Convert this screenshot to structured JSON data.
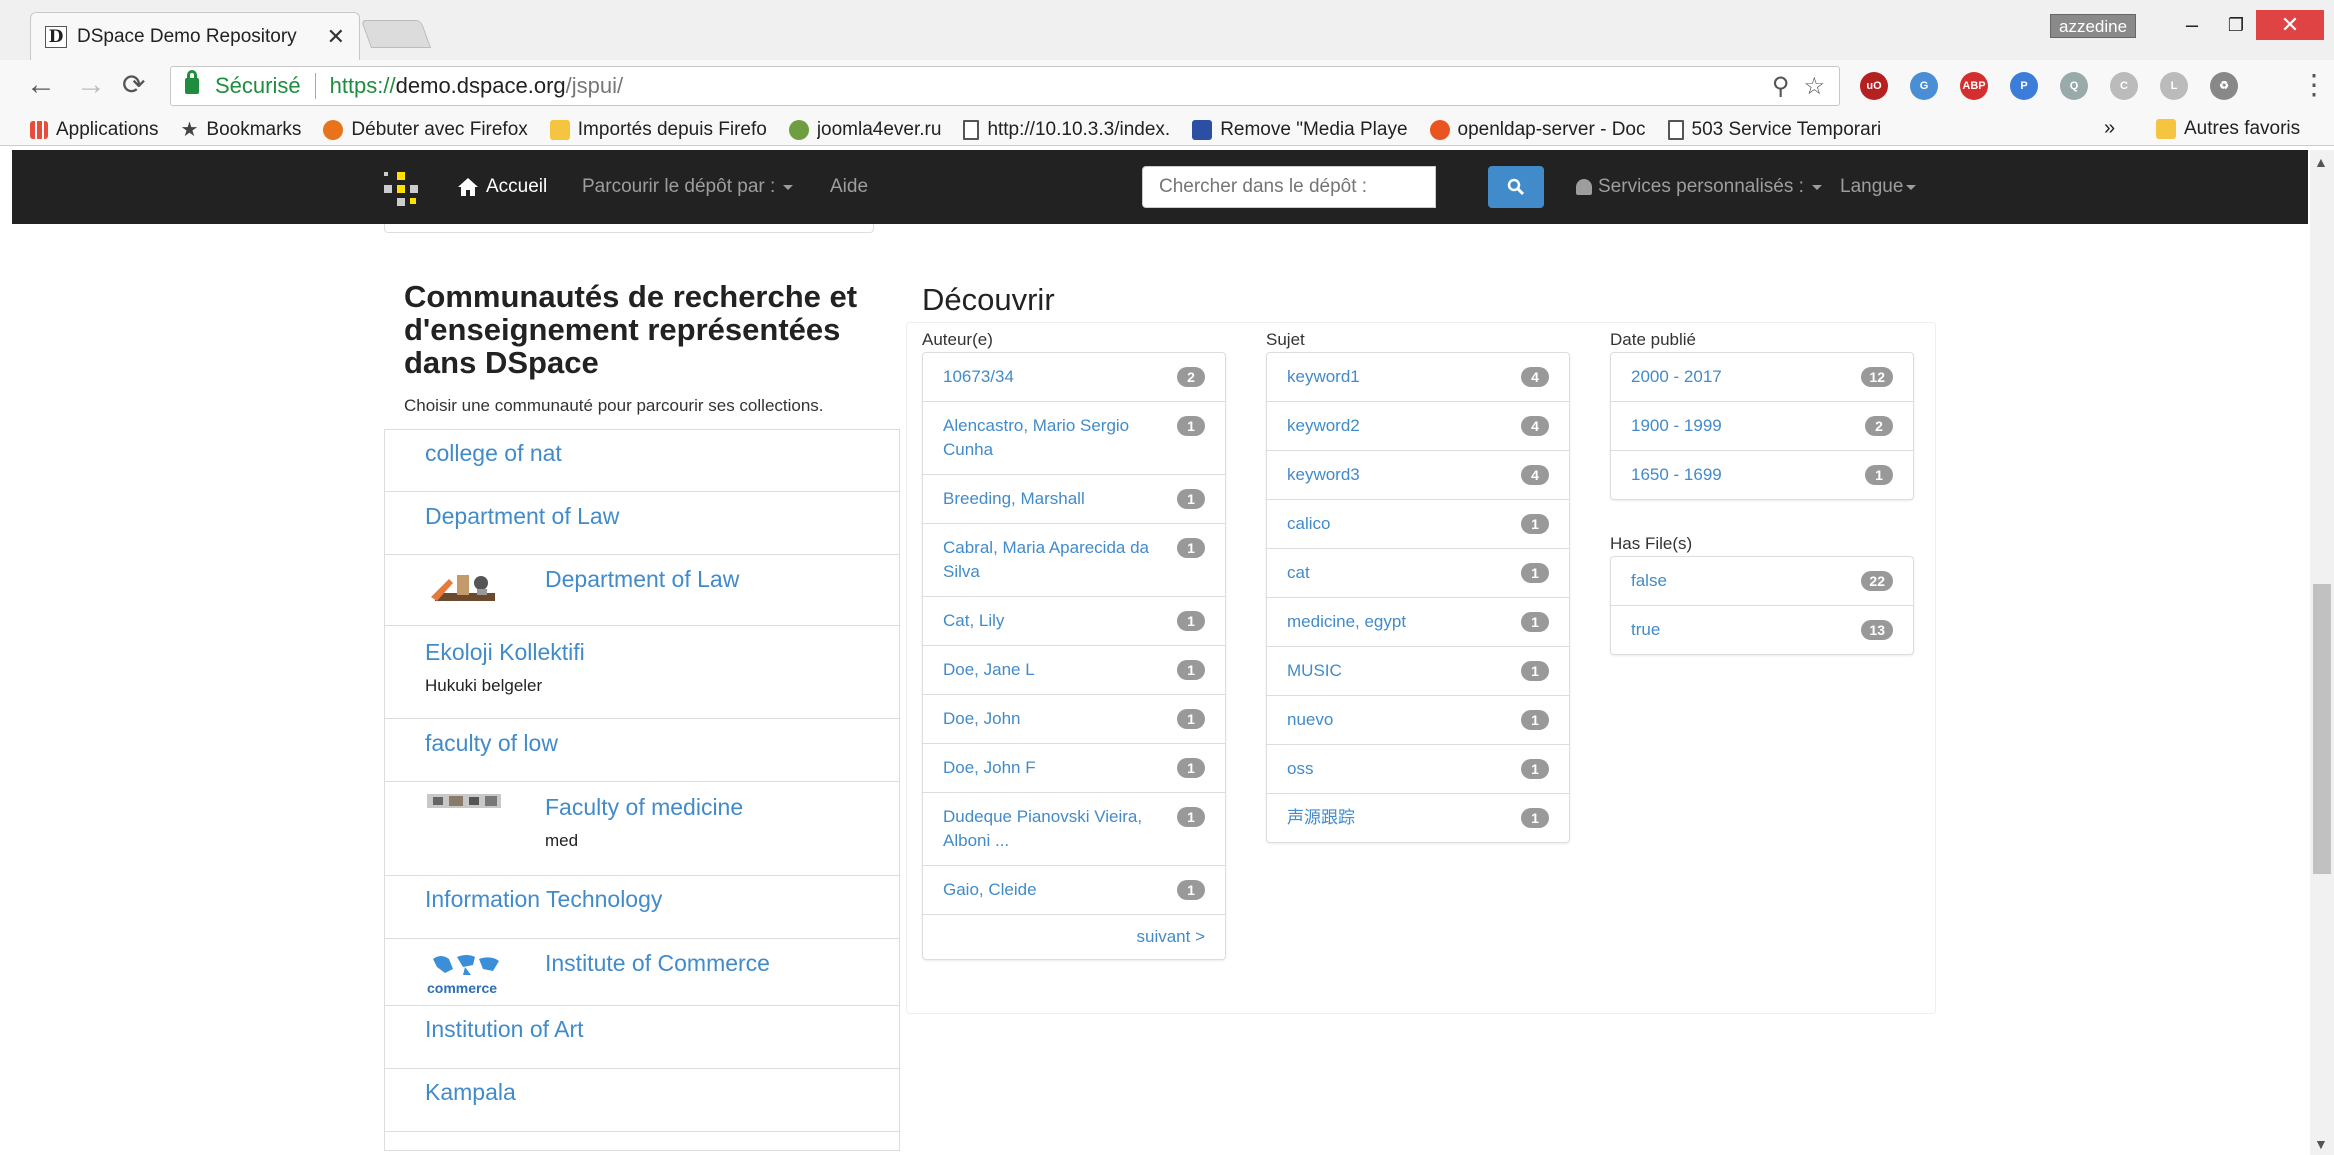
{
  "browser": {
    "tab_title": "DSpace Demo Repository",
    "tab_favicon": "D",
    "user_badge": "azzedine",
    "secure_label": "Sécurisé",
    "url_scheme": "https://",
    "url_host": "demo.dspace.org",
    "url_path": "/jspui/",
    "bookmarks": [
      {
        "label": "Applications",
        "icon": "apps-grid-icon"
      },
      {
        "label": "Bookmarks",
        "icon": "star-icon"
      },
      {
        "label": "Débuter avec Firefox",
        "icon": "firefox-icon"
      },
      {
        "label": "Importés depuis Firefo",
        "icon": "folder-icon"
      },
      {
        "label": "joomla4ever.ru",
        "icon": "joomla-icon"
      },
      {
        "label": "http://10.10.3.3/index.",
        "icon": "document-icon"
      },
      {
        "label": "Remove \"Media Playe",
        "icon": "mt-icon"
      },
      {
        "label": "openldap-server - Doc",
        "icon": "ubuntu-icon"
      },
      {
        "label": "503 Service Temporari",
        "icon": "document-icon"
      }
    ],
    "bookmarks_overflow": "»",
    "other_bookmarks": "Autres favoris"
  },
  "navbar": {
    "home_label": "Accueil",
    "browse_label": "Parcourir le dépôt par :",
    "help_label": "Aide",
    "search_placeholder": "Chercher dans le dépôt :",
    "personal_label": "Services personnalisés :",
    "language_label": "Langue"
  },
  "communities": {
    "title": "Communautés de recherche et d'enseignement représentées dans DSpace",
    "subtitle": "Choisir une communauté pour parcourir ses collections.",
    "items": [
      {
        "name": "college of nat",
        "desc": "",
        "thumb": ""
      },
      {
        "name": "Department of Law",
        "desc": "",
        "thumb": ""
      },
      {
        "name": "Department of Law",
        "desc": "",
        "thumb": "law-thumbnail"
      },
      {
        "name": "Ekoloji Kollektifi",
        "desc": "Hukuki belgeler",
        "thumb": ""
      },
      {
        "name": "faculty of low",
        "desc": "",
        "thumb": ""
      },
      {
        "name": "Faculty of medicine",
        "desc": "med",
        "thumb": "medicine-thumbnail"
      },
      {
        "name": "Information Technology",
        "desc": "",
        "thumb": ""
      },
      {
        "name": "Institute of Commerce",
        "desc": "",
        "thumb": "commerce-thumbnail"
      },
      {
        "name": "Institution of Art",
        "desc": "",
        "thumb": ""
      },
      {
        "name": "Kampala",
        "desc": "",
        "thumb": ""
      }
    ],
    "commerce_thumb_text": "commerce"
  },
  "discover": {
    "title": "Découvrir",
    "author": {
      "label": "Auteur(e)",
      "items": [
        {
          "text": "10673/34",
          "count": "2"
        },
        {
          "text": "Alencastro, Mario Sergio Cunha",
          "count": "1"
        },
        {
          "text": "Breeding, Marshall",
          "count": "1"
        },
        {
          "text": "Cabral, Maria Aparecida da Silva",
          "count": "1"
        },
        {
          "text": "Cat, Lily",
          "count": "1"
        },
        {
          "text": "Doe, Jane L",
          "count": "1"
        },
        {
          "text": "Doe, John",
          "count": "1"
        },
        {
          "text": "Doe, John F",
          "count": "1"
        },
        {
          "text": "Dudeque Pianovski Vieira, Alboni ...",
          "count": "1"
        },
        {
          "text": "Gaio, Cleide",
          "count": "1"
        }
      ],
      "next_label": "suivant >"
    },
    "subject": {
      "label": "Sujet",
      "items": [
        {
          "text": "keyword1",
          "count": "4"
        },
        {
          "text": "keyword2",
          "count": "4"
        },
        {
          "text": "keyword3",
          "count": "4"
        },
        {
          "text": "calico",
          "count": "1"
        },
        {
          "text": "cat",
          "count": "1"
        },
        {
          "text": "medicine, egypt",
          "count": "1"
        },
        {
          "text": "MUSIC",
          "count": "1"
        },
        {
          "text": "nuevo",
          "count": "1"
        },
        {
          "text": "oss",
          "count": "1"
        },
        {
          "text": "声源跟踪",
          "count": "1"
        }
      ]
    },
    "date": {
      "label": "Date publié",
      "items": [
        {
          "text": "2000 - 2017",
          "count": "12"
        },
        {
          "text": "1900 - 1999",
          "count": "2"
        },
        {
          "text": "1650 - 1699",
          "count": "1"
        }
      ]
    },
    "hasfile": {
      "label": "Has File(s)",
      "items": [
        {
          "text": "false",
          "count": "22"
        },
        {
          "text": "true",
          "count": "13"
        }
      ]
    }
  },
  "colors": {
    "link": "#428bca",
    "navbar_bg": "#222222",
    "badge_bg": "#999999",
    "secure_green": "#1e8e3e"
  }
}
